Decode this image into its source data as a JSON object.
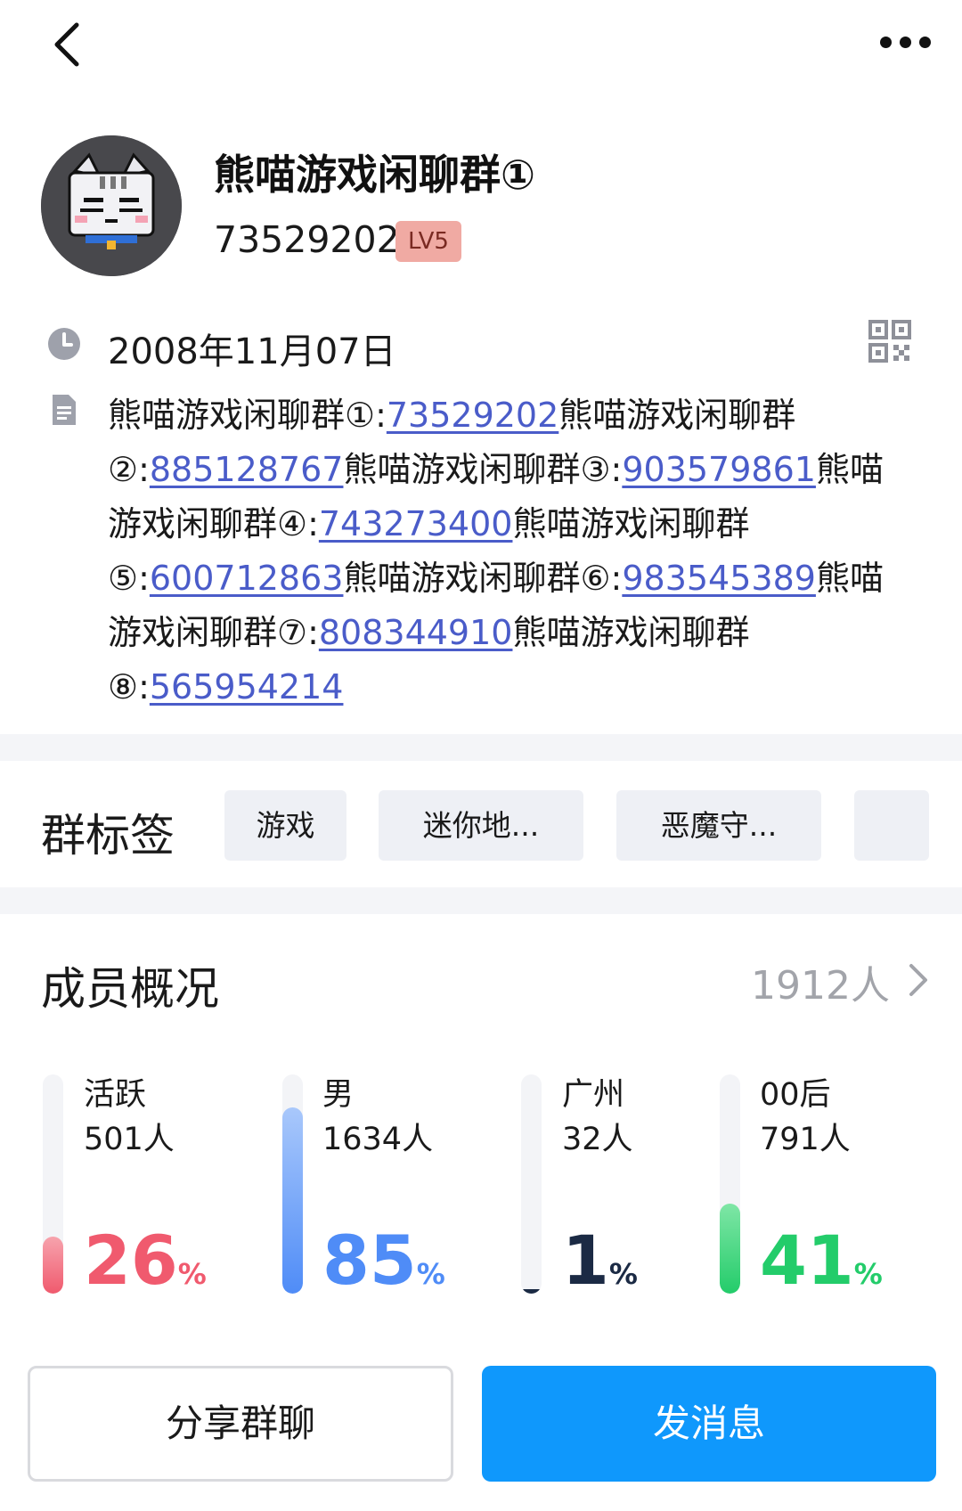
{
  "header": {
    "group_name": "熊喵游戏闲聊群①",
    "group_id": "73529202",
    "level_badge": "LV5"
  },
  "info": {
    "created_date": "2008年11月07日",
    "description": [
      {
        "text": "熊喵游戏闲聊群①:"
      },
      {
        "text": "73529202",
        "link": true
      },
      {
        "text": "熊喵游戏闲聊群②:"
      },
      {
        "text": "885128767",
        "link": true
      },
      {
        "text": "熊喵游戏闲聊群③:"
      },
      {
        "text": "903579861",
        "link": true
      },
      {
        "text": "熊喵游戏闲聊群④:"
      },
      {
        "text": "743273400",
        "link": true
      },
      {
        "text": "熊喵游戏闲聊群⑤:"
      },
      {
        "text": "600712863",
        "link": true
      },
      {
        "text": "熊喵游戏闲聊群⑥:"
      },
      {
        "text": "983545389",
        "link": true
      },
      {
        "text": "熊喵游戏闲聊群⑦:"
      },
      {
        "text": "808344910",
        "link": true
      },
      {
        "text": "熊喵游戏闲聊群⑧:"
      },
      {
        "text": "565954214",
        "link": true
      }
    ]
  },
  "tags": {
    "title": "群标签",
    "items": [
      "游戏",
      "迷你地...",
      "恶魔守...",
      ""
    ]
  },
  "members": {
    "title": "成员概况",
    "total": "1912人",
    "stats": [
      {
        "label": "活跃",
        "count": "501人",
        "percent": 26,
        "unit": "%",
        "color": "#f05a6e",
        "fill_start": "#f7a3ad",
        "fill_end": "#f05a6e"
      },
      {
        "label": "男",
        "count": "1634人",
        "percent": 85,
        "unit": "%",
        "color": "#4f8cf7",
        "fill_start": "#a9c8fb",
        "fill_end": "#4f8cf7"
      },
      {
        "label": "广州",
        "count": "32人",
        "percent": 1,
        "unit": "%",
        "color": "#1b2a44",
        "fill_start": "#1b2a44",
        "fill_end": "#1b2a44"
      },
      {
        "label": "00后",
        "count": "791人",
        "percent": 41,
        "unit": "%",
        "color": "#23cc6a",
        "fill_start": "#7fe6a6",
        "fill_end": "#23cc6a"
      }
    ]
  },
  "actions": {
    "share_label": "分享群聊",
    "send_label": "发消息"
  },
  "colors": {
    "link": "#4a5cc9",
    "primary": "#0f98fc",
    "muted": "#a2a4aa"
  }
}
